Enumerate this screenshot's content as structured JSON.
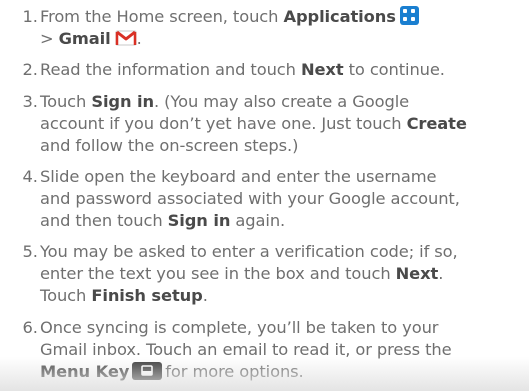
{
  "steps": [
    {
      "num": "1.",
      "lines": [
        "From the Home screen, touch",
        "Applications",
        ">",
        "Gmail",
        "."
      ]
    },
    {
      "num": "2.",
      "lines": [
        "Read the information and touch",
        "Next",
        "to continue."
      ]
    },
    {
      "num": "3.",
      "lines": [
        "Touch",
        "Sign in",
        ". (You may also create a Google",
        "account if you don’t yet have one. Just touch",
        "Create",
        "and follow the on-screen steps.)"
      ]
    },
    {
      "num": "4.",
      "lines": [
        "Slide open the keyboard and enter the username",
        "and password associated with your Google account,",
        "and then touch",
        "Sign in",
        "again."
      ]
    },
    {
      "num": "5.",
      "lines": [
        "You may be asked to enter a verification code; if so,",
        "enter the text you see in the box and touch",
        "Next",
        ".",
        "Touch",
        "Finish setup",
        "."
      ]
    },
    {
      "num": "6.",
      "lines": [
        "Once syncing is complete, you’ll be taken to your",
        "Gmail inbox. Touch an email to read it, or press the",
        "Menu Key",
        "for more options."
      ]
    }
  ],
  "icons": {
    "applications": "apps-grid-icon",
    "gmail": "gmail-envelope-icon",
    "menu_key": "menu-key-icon"
  },
  "colors": {
    "text": "#6f6f6f",
    "bold_text": "#4a4a4a",
    "applications_icon": "#1a7fd0",
    "gmail_red": "#d93025",
    "menu_key": "#3a3a3a"
  }
}
